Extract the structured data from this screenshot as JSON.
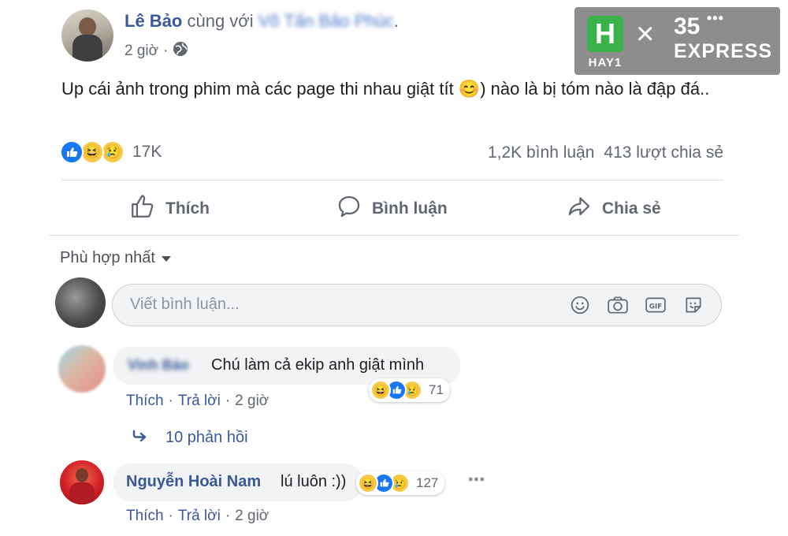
{
  "post": {
    "author": "Lê Bảo",
    "with_text": "cùng với",
    "tagged_blurred": "Võ Tấn Bảo Phúc",
    "time": "2 giờ",
    "body": "Up cái ảnh trong phim mà các page thi nhau giật tít 😊) nào là bị tóm nào là đập đá..",
    "reaction_count": "17K",
    "comments_count": "1,2K bình luận",
    "shares_count": "413 lượt chia sẻ",
    "reaction_icons": [
      "like",
      "haha",
      "sad"
    ]
  },
  "actions": {
    "like": "Thích",
    "comment": "Bình luận",
    "share": "Chia sẻ"
  },
  "sort": {
    "label": "Phù hợp nhất"
  },
  "composer": {
    "placeholder": "Viết bình luận..."
  },
  "comments": [
    {
      "author_blurred": "Vinh Bảo",
      "text": "Chú làm cả ekip anh giật mình",
      "reaction_count": "71",
      "like": "Thích",
      "reply": "Trả lời",
      "time": "2 giờ",
      "replies_label": "10 phản hồi"
    },
    {
      "author": "Nguyễn Hoài Nam",
      "text": "lú luôn :))",
      "reaction_count": "127",
      "like": "Thích",
      "reply": "Trả lời",
      "time": "2 giờ"
    }
  ],
  "watermark": {
    "brand_left": "HAY1",
    "letter": "H",
    "times": "×",
    "brand_right_top": "35",
    "brand_right_bottom": "EXPRESS",
    "dots": "•••"
  },
  "colors": {
    "link": "#385898",
    "like_blue": "#1877f2",
    "haha_yellow": "#f7c948",
    "watermark_bg": "#8d8d8d",
    "logo_green": "#3cb34a"
  }
}
